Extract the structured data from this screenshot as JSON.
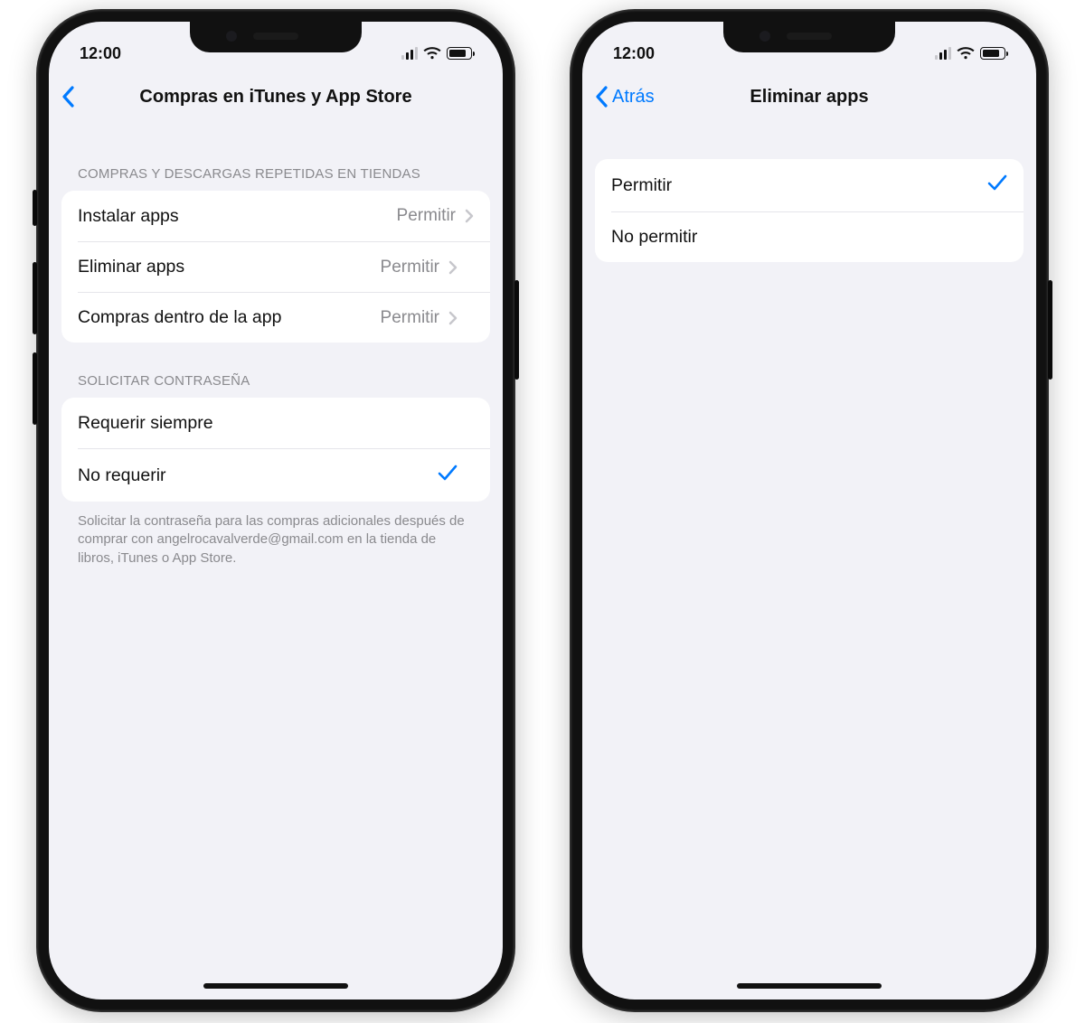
{
  "status": {
    "time": "12:00"
  },
  "colors": {
    "accent": "#007aff",
    "bg": "#f2f2f7",
    "groupBg": "#ffffff",
    "secondary": "#8a8a8e"
  },
  "phone1": {
    "nav": {
      "title": "Compras en iTunes y App Store",
      "backLabel": ""
    },
    "section1": {
      "header": "COMPRAS Y DESCARGAS REPETIDAS EN TIENDAS",
      "rows": [
        {
          "label": "Instalar apps",
          "value": "Permitir"
        },
        {
          "label": "Eliminar apps",
          "value": "Permitir"
        },
        {
          "label": "Compras dentro de la app",
          "value": "Permitir"
        }
      ]
    },
    "section2": {
      "header": "SOLICITAR CONTRASEÑA",
      "rows": [
        {
          "label": "Requerir siempre",
          "checked": false
        },
        {
          "label": "No requerir",
          "checked": true
        }
      ],
      "footnote": "Solicitar la contraseña para las compras adicionales después de comprar con angelrocavalverde@gmail.com en la tienda de libros, iTunes o App Store."
    }
  },
  "phone2": {
    "nav": {
      "title": "Eliminar apps",
      "backLabel": "Atrás"
    },
    "section1": {
      "rows": [
        {
          "label": "Permitir",
          "checked": true
        },
        {
          "label": "No permitir",
          "checked": false
        }
      ]
    }
  }
}
